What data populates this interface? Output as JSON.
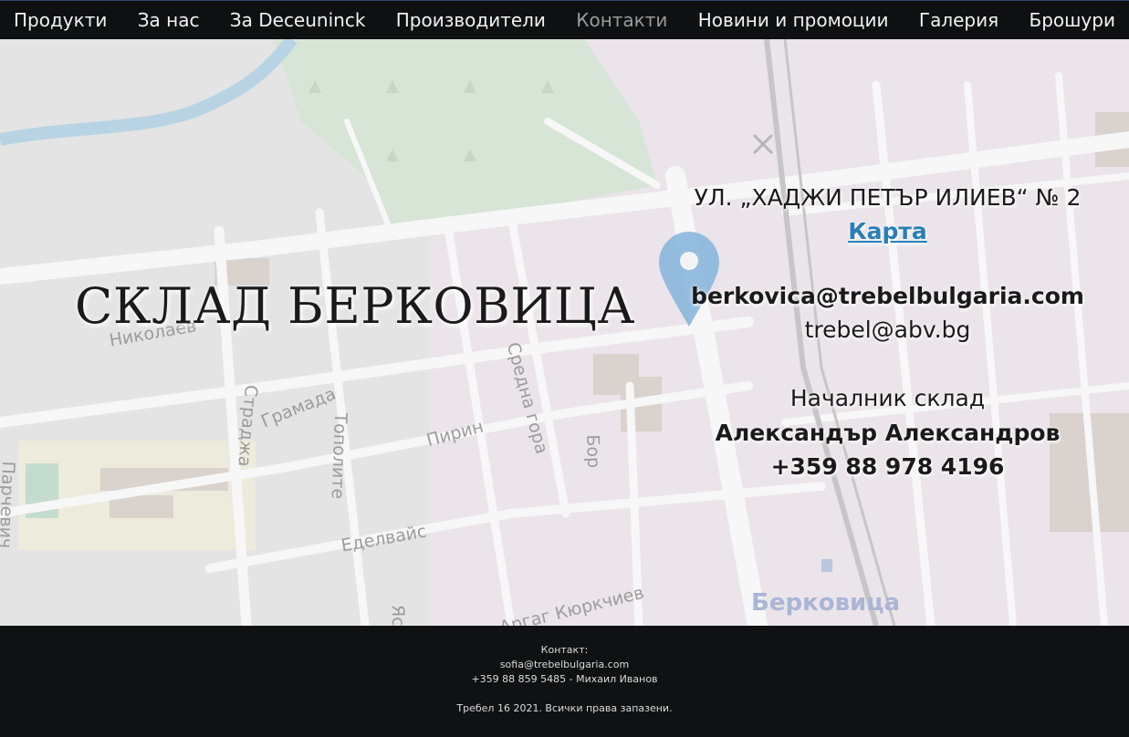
{
  "nav": {
    "items": [
      {
        "label": "Продукти"
      },
      {
        "label": "За нас"
      },
      {
        "label": "За Deceuninck"
      },
      {
        "label": "Производители"
      },
      {
        "label": "Контакти",
        "active": true
      },
      {
        "label": "Новини и промоции"
      },
      {
        "label": "Галерия"
      },
      {
        "label": "Брошури"
      }
    ]
  },
  "map": {
    "street_labels": [
      "Николаев",
      "Страджа",
      "Грамада",
      "Тополите",
      "Пирин",
      "Средна гора",
      "Бор",
      "Еделвайс",
      "Парчевич",
      "Яс",
      "Аргаг Кюркчиев"
    ],
    "town_label": "Берковица",
    "marker_icon": "map-pin-icon"
  },
  "page": {
    "title": "СКЛАД БЕРКОВИЦА"
  },
  "contact": {
    "address": "УЛ. „ХАДЖИ ПЕТЪР ИЛИЕВ“ № 2",
    "map_link": "Карта",
    "email_primary": "berkovica@trebelbulgaria.com",
    "email_secondary": "trebel@abv.bg",
    "role": "Началник склад",
    "name": "Александър Александров",
    "phone": "+359 88 978 4196"
  },
  "footer": {
    "contact_label": "Контакт:",
    "email": "sofia@trebelbulgaria.com",
    "phone_line": "+359 88 859 5485 - Михаил Иванов",
    "copyright": "Требел 16 2021. Всички права запазени."
  },
  "colors": {
    "nav_bg": "#0e1011",
    "link": "#2a7fb8",
    "marker": "#7fb0dc"
  }
}
